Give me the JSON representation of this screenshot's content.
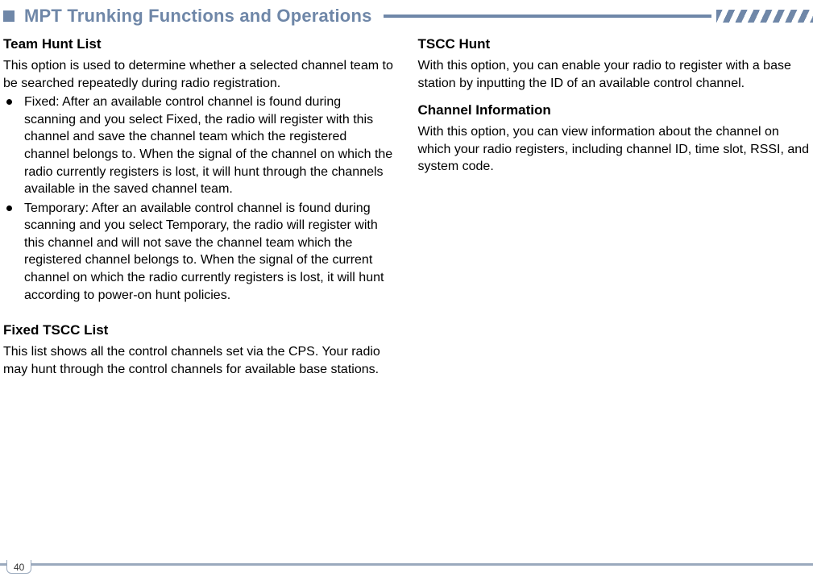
{
  "header": {
    "title": "MPT Trunking Functions and Operations"
  },
  "left": {
    "h1": "Team Hunt List",
    "p1": "This option is used to determine whether a selected channel team to be searched repeatedly during radio registration.",
    "b1": "Fixed:  After an available control channel is found during scanning and you select Fixed, the radio will register with this channel and save the channel team which the registered channel belongs to. When the signal of the channel on which the radio currently registers is lost, it will hunt through the channels available in the saved channel team.",
    "b2": "Temporary: After an available control channel is found during scanning and you select Temporary, the radio will register with this channel and will not save the channel team which the registered channel belongs to. When the signal of the current channel on which the radio currently registers is lost, it will hunt according to power-on hunt policies.",
    "h2": "Fixed TSCC List",
    "p2": "This list shows all the control channels set via the CPS. Your radio may hunt through the control channels for available base stations."
  },
  "right": {
    "h1": "TSCC Hunt",
    "p1": "With this option, you can enable your radio to register with a base station by inputting the ID of  an available control channel.",
    "h2": "Channel Information",
    "p2": "With this option, you can view information about the channel on which your radio registers, including channel ID, time slot, RSSI, and system code."
  },
  "footer": {
    "page": "40"
  }
}
